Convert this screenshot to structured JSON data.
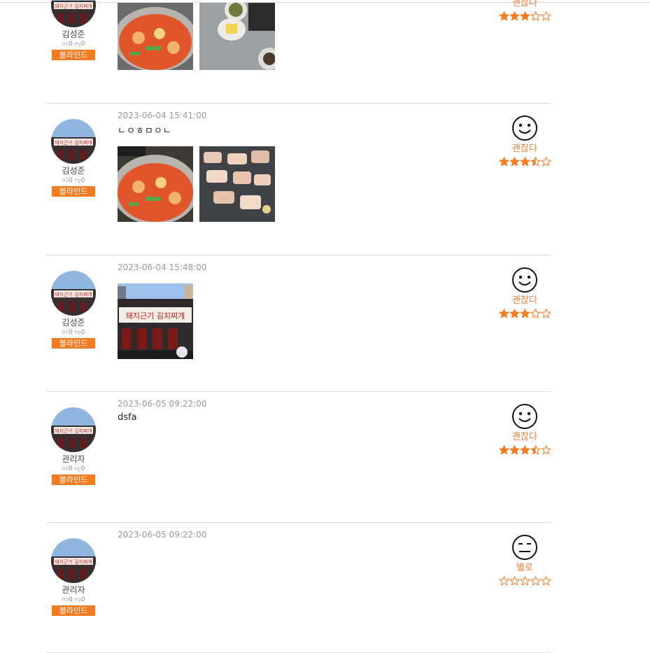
{
  "brand_color": "#f47b20",
  "reviews": [
    {
      "user": "김성준",
      "likes": "0",
      "dislikes": "0",
      "blind_label": "블라인드",
      "date": "",
      "text": "",
      "rating_label": "괜찮다",
      "stars": 3,
      "face": "smile-face-icon",
      "images": [
        "kimchi-stew-photo",
        "side-dishes-photo"
      ]
    },
    {
      "user": "김성준",
      "likes": "0",
      "dislikes": "0",
      "blind_label": "블라인드",
      "date": "2023-06-04 15:41:00",
      "text": "ㄴㅇㅎㅁㅇㄴ",
      "rating_label": "괜찮다",
      "stars": 3.5,
      "face": "smile-face-icon",
      "images": [
        "kimchi-stew-photo",
        "grilled-pork-photo"
      ]
    },
    {
      "user": "김성준",
      "likes": "0",
      "dislikes": "0",
      "blind_label": "블라인드",
      "date": "2023-06-04 15:48:00",
      "text": "",
      "rating_label": "괜찮다",
      "stars": 3,
      "face": "smile-face-icon",
      "images": [
        "restaurant-storefront-photo"
      ]
    },
    {
      "user": "관리자",
      "likes": "0",
      "dislikes": "0",
      "blind_label": "블라인드",
      "date": "2023-06-05 09:22:00",
      "text": "dsfa",
      "rating_label": "괜찮다",
      "stars": 3.5,
      "face": "smile-face-icon",
      "images": []
    },
    {
      "user": "관리자",
      "likes": "0",
      "dislikes": "0",
      "blind_label": "블라인드",
      "date": "2023-06-05 09:22:00",
      "text": "",
      "rating_label": "별로",
      "stars": 0,
      "face": "neutral-face-icon",
      "images": []
    }
  ]
}
